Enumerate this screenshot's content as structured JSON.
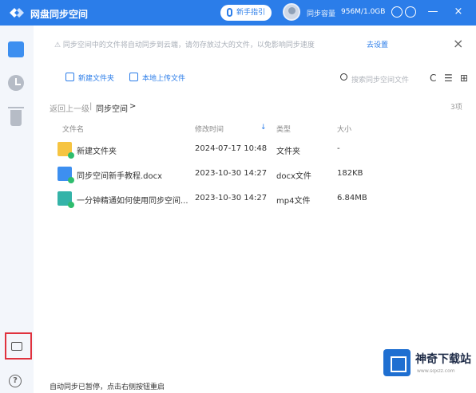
{
  "titlebar": {
    "app_title": "网盘同步空间",
    "record_button": "新手指引",
    "space_label": "同步容量",
    "space_value": "956M/1.0GB",
    "minimize": "—",
    "close": "×"
  },
  "notice": {
    "text": "⚠ 同步空间中的文件将自动同步到云端，请勿存放过大的文件，以免影响同步速度",
    "link": "去设置",
    "close": "×"
  },
  "toolbar": {
    "new_folder": "新建文件夹",
    "upload": "本地上传文件",
    "search_placeholder": "搜索同步空间文件",
    "refresh": "C",
    "sort": "☰",
    "grid": "⊞"
  },
  "breadcrumb": {
    "back": "返回上一级",
    "sep": "|",
    "current": "同步空间",
    "arrow": ">",
    "count": "3项"
  },
  "table": {
    "headers": {
      "name": "文件名",
      "modified": "修改时间",
      "type": "类型",
      "size": "大小"
    },
    "sort_arrow": "↓",
    "rows": [
      {
        "name": "新建文件夹",
        "modified": "2024-07-17 10:48",
        "type": "文件夹",
        "size": "-",
        "icon": "folder"
      },
      {
        "name": "同步空间新手教程.docx",
        "modified": "2023-10-30 14:27",
        "type": "docx文件",
        "size": "182KB",
        "icon": "doc"
      },
      {
        "name": "一分钟精通如何使用同步空间...",
        "modified": "2023-10-30 14:27",
        "type": "mp4文件",
        "size": "6.84MB",
        "icon": "video"
      }
    ]
  },
  "status": "自动同步已暂停，点击右侧按钮重启",
  "watermark": {
    "title": "神奇下载站",
    "url": "www.sqxzz.com"
  }
}
